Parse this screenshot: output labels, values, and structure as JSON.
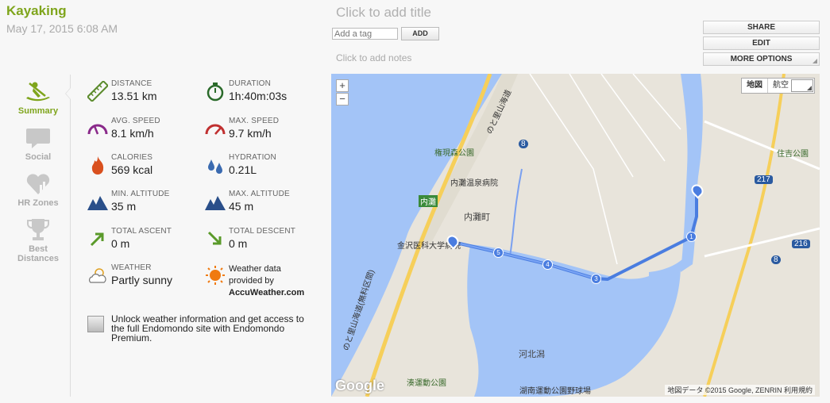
{
  "workout": {
    "title": "Kayaking",
    "date": "May 17, 2015 6:08 AM"
  },
  "header": {
    "add_title": "Click to add title",
    "tag_placeholder": "Add a tag",
    "add_button": "ADD",
    "add_notes": "Click to add notes"
  },
  "actions": {
    "share": "SHARE",
    "edit": "EDIT",
    "more": "MORE OPTIONS"
  },
  "nav": {
    "summary": "Summary",
    "social": "Social",
    "hr_zones": "HR Zones",
    "best_l1": "Best",
    "best_l2": "Distances"
  },
  "stats": {
    "distance": {
      "label": "DISTANCE",
      "value": "13.51 km",
      "icon": "ruler-icon"
    },
    "duration": {
      "label": "DURATION",
      "value": "1h:40m:03s",
      "icon": "stopwatch-icon"
    },
    "avg_speed": {
      "label": "AVG. SPEED",
      "value": "8.1 km/h",
      "icon": "speedometer-icon"
    },
    "max_speed": {
      "label": "MAX. SPEED",
      "value": "9.7 km/h",
      "icon": "speedometer-max-icon"
    },
    "calories": {
      "label": "CALORIES",
      "value": "569 kcal",
      "icon": "flame-icon"
    },
    "hydration": {
      "label": "HYDRATION",
      "value": "0.21L",
      "icon": "drops-icon"
    },
    "min_alt": {
      "label": "MIN. ALTITUDE",
      "value": "35 m",
      "icon": "mountain-icon"
    },
    "max_alt": {
      "label": "MAX. ALTITUDE",
      "value": "45 m",
      "icon": "mountain-icon"
    },
    "ascent": {
      "label": "TOTAL ASCENT",
      "value": "0 m",
      "icon": "arrow-up-right-icon"
    },
    "descent": {
      "label": "TOTAL DESCENT",
      "value": "0 m",
      "icon": "arrow-down-right-icon"
    },
    "weather": {
      "label": "WEATHER",
      "value": "Partly sunny",
      "icon": "partly-sunny-icon"
    },
    "weather_provider": {
      "line1": "Weather data",
      "line2": "provided by",
      "line3": "AccuWeather.com"
    }
  },
  "unlock": {
    "text": "Unlock weather information and get access to the full Endomondo site with Endomondo Premium."
  },
  "map": {
    "zoom_in": "+",
    "zoom_out": "−",
    "type_map": "地図",
    "type_sat": "航空",
    "copyright": "地図データ ©2015 Google, ZENRIN    利用規約",
    "google": "Google",
    "labels": {
      "park1": "権現森公園",
      "hospital": "内灘温泉病院",
      "town": "内灘町",
      "station": "内灘",
      "univ": "金沢医科大学病院",
      "lagoon": "河北潟",
      "park2": "湊運動公園",
      "stadium": "湖南運動公園野球場",
      "park3": "住吉公園",
      "road1": "のと里山海道",
      "road2": "のと里山海道(無料区間)",
      "r8a": "8",
      "r8b": "8",
      "r217": "217",
      "r216": "216"
    },
    "markers": [
      "5",
      "4",
      "3",
      "1"
    ]
  },
  "colors": {
    "accent": "#7fa51c",
    "route": "#4a7de0",
    "water": "#a3c4f7"
  }
}
